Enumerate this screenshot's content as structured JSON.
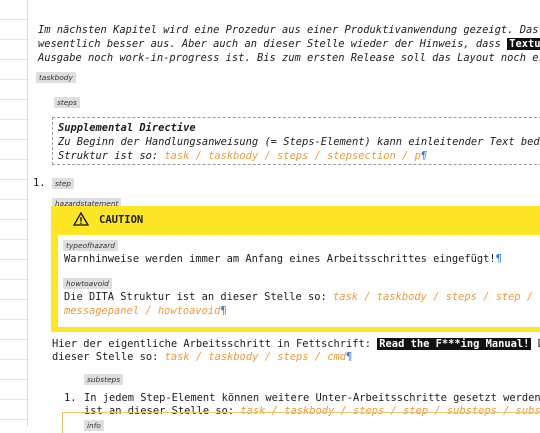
{
  "intro": {
    "line1": "Im nächsten Kapitel wird eine Prozedur aus einer Produktivanwendung gezeigt. Das sie",
    "line2_pre": "wesentlich besser aus. Aber auch an dieser Stelle wieder der Hinweis, dass ",
    "line2_hl": "Textur",
    "line2_post": " u",
    "line3": "Ausgabe noch work-in-progress ist. Bis zum ersten Release soll das Layout noch erheb"
  },
  "tags": {
    "taskbody": "taskbody",
    "steps": "steps",
    "step": "step",
    "hazardstatement": "hazardstatement",
    "typeofhazard": "typeofhazard",
    "howtoavoid": "howtoavoid",
    "substeps": "substeps",
    "info": "info"
  },
  "supplemental": {
    "title": "Supplemental Directive",
    "line1": "Zu Beginn der Handlungsanweisung (= Steps-Element) kann einleitender Text bedate",
    "line2_pre": "Struktur ist so: ",
    "line2_path": "task / taskbody / steps / stepsection / p",
    "pilcrow": "¶"
  },
  "step1": {
    "number": "1.",
    "caution_label": "CAUTION",
    "typeofhazard_text": "Warnhinweise werden immer am Anfang eines Arbeitsschrittes eingefügt!",
    "howtoavoid_pre": "Die DITA Struktur ist an dieser Stelle so: ",
    "howtoavoid_path1": "task / taskbody / steps / step / haz",
    "howtoavoid_path2": "messagepanel / howtoavoid",
    "cmd_pre": "Hier der eigentliche Arbeitsschritt in Fettschrift: ",
    "cmd_hl": "Read the F***ing Manual!",
    "cmd_post": " Die",
    "cmd_line2_pre": "dieser Stelle so: ",
    "cmd_line2_path": "task / taskbody / steps / cmd"
  },
  "substep1": {
    "number": "1.",
    "line1": "In jedem Step-Element können weitere Unter-Arbeitsschritte gesetzt werden. D",
    "line2_pre": "ist an dieser Stelle so: ",
    "line2_path": "task / taskbody / steps / step / substeps / substep"
  },
  "colors": {
    "hazard_yellow": "#fde626",
    "path_orange": "#ef9a3c",
    "pilcrow_blue": "#3b7bd6",
    "tag_gray": "#dedede"
  },
  "icons": {
    "warning": "warning-triangle-icon"
  }
}
